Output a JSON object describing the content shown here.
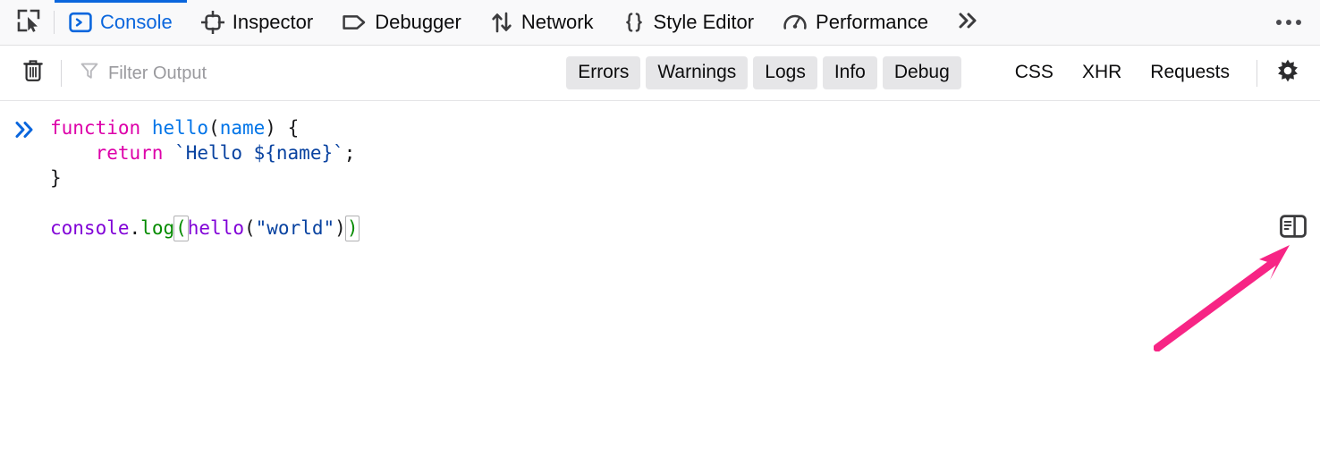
{
  "toolbar": {
    "picker_icon": "element-picker-icon",
    "overflow_icon": "chevron-double-right-icon",
    "menu_icon": "meatball-menu-icon",
    "tabs": [
      {
        "label": "Console",
        "icon": "console-prompt-icon",
        "active": true
      },
      {
        "label": "Inspector",
        "icon": "inspector-target-icon",
        "active": false
      },
      {
        "label": "Debugger",
        "icon": "debugger-tag-icon",
        "active": false
      },
      {
        "label": "Network",
        "icon": "network-arrows-icon",
        "active": false
      },
      {
        "label": "Style Editor",
        "icon": "style-braces-icon",
        "active": false
      },
      {
        "label": "Performance",
        "icon": "performance-gauge-icon",
        "active": false
      }
    ]
  },
  "filterbar": {
    "clear_icon": "trash-icon",
    "filter_icon": "funnel-icon",
    "settings_icon": "gear-icon",
    "search": {
      "placeholder": "Filter Output",
      "value": ""
    },
    "pills": [
      "Errors",
      "Warnings",
      "Logs",
      "Info",
      "Debug"
    ],
    "plain": [
      "CSS",
      "XHR",
      "Requests"
    ]
  },
  "console": {
    "prompt_icon": "double-chevron-prompt-icon",
    "panel_toggle_icon": "split-console-panel-icon",
    "annotation_icon": "pink-pointer-arrow",
    "annotation_color": "#f72585",
    "input": {
      "line1": {
        "kw_function": "function",
        "fn_name": "hello",
        "paren_open": "(",
        "param": "name",
        "paren_close": ")",
        "space": " ",
        "brace_open": "{"
      },
      "line2": {
        "indent": "  ",
        "kw_return": "return",
        "space": " ",
        "template": "`Hello ${name}`",
        "semicolon": ";"
      },
      "line3": {
        "brace_close": "}"
      },
      "line5": {
        "obj": "console",
        "dot": ".",
        "method": "log",
        "paren_open": "(",
        "inner_fn": "hello",
        "inner_paren_open": "(",
        "arg": "\"world\"",
        "inner_paren_close": ")",
        "paren_close": ")"
      }
    }
  },
  "colors": {
    "accent": "#0a66dd",
    "keyword": "#dd00a9",
    "function": "#0074e8",
    "string": "#0842a0",
    "object": "#8000d7",
    "method": "#058b00",
    "annotation": "#f72585",
    "toolbar_bg": "#f9f9fa",
    "pill_bg": "#e6e6e8"
  }
}
